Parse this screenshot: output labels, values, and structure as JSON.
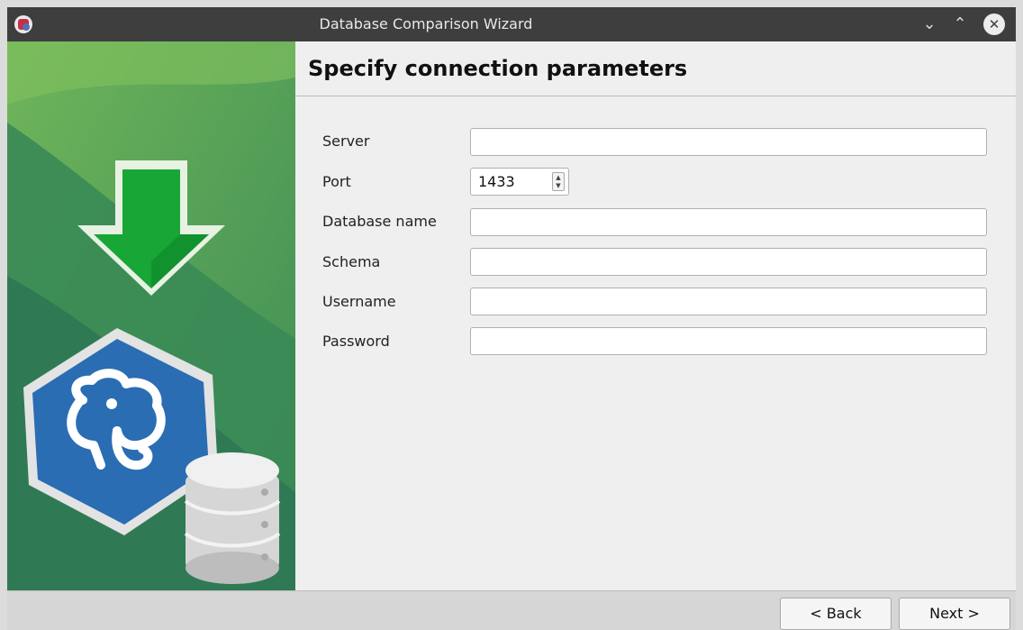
{
  "window": {
    "title": "Database Comparison Wizard",
    "icon": "database-compare-app-icon",
    "controls": [
      "chevron-down-icon",
      "chevron-up-icon",
      "close-icon"
    ]
  },
  "page": {
    "heading": "Specify connection parameters"
  },
  "form": {
    "server": {
      "label": "Server",
      "value": ""
    },
    "port": {
      "label": "Port",
      "value": "1433"
    },
    "database": {
      "label": "Database name",
      "value": ""
    },
    "schema": {
      "label": "Schema",
      "value": ""
    },
    "username": {
      "label": "Username",
      "value": ""
    },
    "password": {
      "label": "Password",
      "value": ""
    }
  },
  "footer": {
    "back_label": "< Back",
    "next_label": "Next >"
  },
  "sidebar": {
    "icons": [
      "download-arrow-icon",
      "postgresql-elephant-icon",
      "database-icon"
    ]
  },
  "colors": {
    "sidebar_green": "#4f9a52",
    "sidebar_dark": "#2f7a54",
    "arrow_green": "#16a034",
    "badge_blue": "#2a6db3",
    "titlebar": "#3e3e3e"
  }
}
